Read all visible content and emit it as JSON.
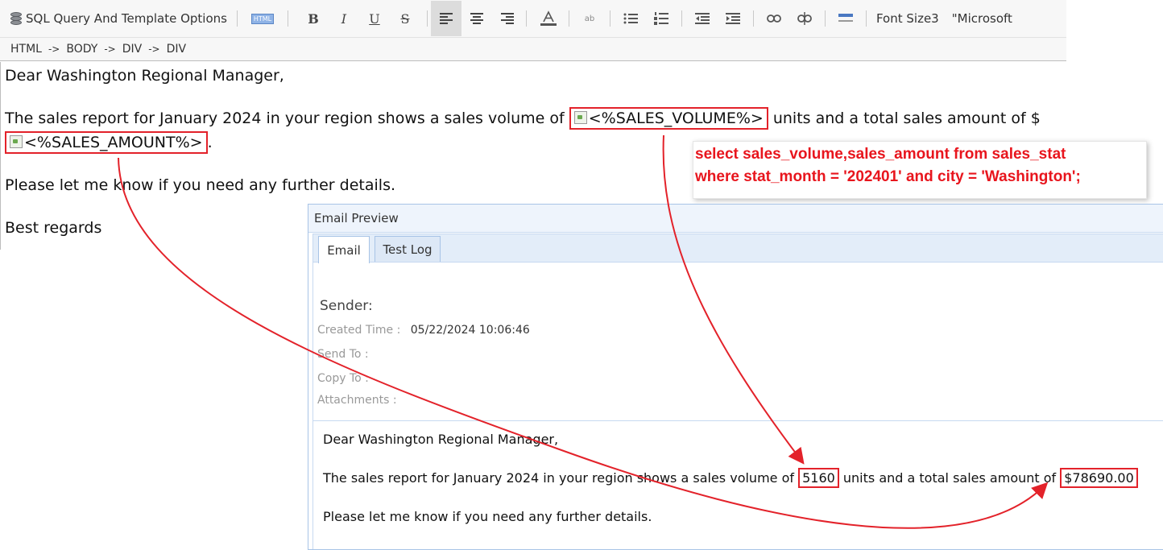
{
  "toolbar": {
    "title": "SQL Query And Template Options",
    "html_badge": "HTML",
    "bold": "B",
    "italic": "I",
    "underline": "U",
    "strike": "S",
    "spell": "ab",
    "font_size": "Font Size3",
    "font_name": "\"Microsoft"
  },
  "breadcrumb": [
    "HTML",
    "->",
    "BODY",
    "->",
    "DIV",
    "->",
    "DIV"
  ],
  "editor": {
    "greeting": "Dear Washington Regional Manager,",
    "line1_prefix": "The sales report for January 2024 in your region shows a sales volume of ",
    "placeholder_volume": "<%SALES_VOLUME%>",
    "line1_mid": " units and a total sales amount of $",
    "placeholder_amount": "<%SALES_AMOUNT%>",
    "line2_suffix": ".",
    "line3": "Please let me know if you need any further details.",
    "closing": "Best regards"
  },
  "sql": {
    "line1": "select sales_volume,sales_amount from sales_stat",
    "line2": "where stat_month = '202401' and city = 'Washington';"
  },
  "preview": {
    "title": "Email Preview",
    "tabs": [
      "Email",
      "Test Log"
    ],
    "sender_label": "Sender:",
    "created_label": "Created Time :",
    "created_value": "05/22/2024 10:06:46",
    "send_to_label": "Send To :",
    "copy_to_label": "Copy To :",
    "attachments_label": "Attachments :",
    "greeting": "Dear Washington Regional Manager,",
    "line1_prefix": "The sales report for January 2024 in your region shows a sales volume of ",
    "volume_value": "5160",
    "line1_mid": " units and a total sales amount of ",
    "amount_value": "$78690.00",
    "line3": "Please let me know if you need any further details."
  },
  "colors": {
    "annotation_red": "#e3222a",
    "sql_text": "#e8151d",
    "preview_border": "#a8c4e6"
  },
  "icons": [
    "database-icon",
    "align-left-icon",
    "align-center-icon",
    "align-right-icon",
    "font-color-icon",
    "spellcheck-icon",
    "bullet-list-icon",
    "numbered-list-icon",
    "outdent-icon",
    "indent-icon",
    "link-icon",
    "unlink-icon",
    "horizontal-rule-icon"
  ]
}
